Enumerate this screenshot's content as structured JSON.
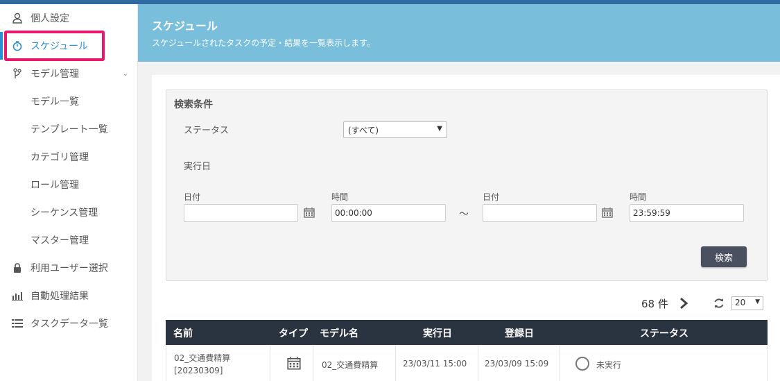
{
  "sidebar": {
    "items": [
      {
        "label": "個人設定",
        "icon": "user-icon"
      },
      {
        "label": "スケジュール",
        "icon": "stopwatch-icon"
      },
      {
        "label": "モデル管理",
        "icon": "branch-icon"
      },
      {
        "label": "モデル一覧"
      },
      {
        "label": "テンプレート一覧"
      },
      {
        "label": "カテゴリ管理"
      },
      {
        "label": "ロール管理"
      },
      {
        "label": "シーケンス管理"
      },
      {
        "label": "マスター管理"
      },
      {
        "label": "利用ユーザー選択",
        "icon": "lock-icon"
      },
      {
        "label": "自動処理結果",
        "icon": "bar-chart-icon"
      },
      {
        "label": "タスクデータ一覧",
        "icon": "list-icon"
      }
    ]
  },
  "header": {
    "title": "スケジュール",
    "description": "スケジュールされたタスクの予定・結果を一覧表示します。"
  },
  "search": {
    "title": "検索条件",
    "status_label": "ステータス",
    "status_value": "(すべて)",
    "exec_date_label": "実行日",
    "date_label": "日付",
    "time_label": "時間",
    "start_date": "",
    "start_time": "00:00:00",
    "tilde": "～",
    "end_date": "",
    "end_time": "23:59:59",
    "button": "検索"
  },
  "pagination": {
    "count": "68 件",
    "page_size": "20"
  },
  "table": {
    "columns": [
      "名前",
      "タイプ",
      "モデル名",
      "実行日",
      "登録日",
      "ステータス"
    ],
    "rows": [
      {
        "name_line1": "02_交通費精算",
        "name_line2": "[20230309]",
        "type_icon": "calendar-icon",
        "model": "02_交通費精算",
        "exec_date": "23/03/11 15:00",
        "reg_date": "23/03/09 15:09",
        "status": "未実行"
      }
    ]
  },
  "colors": {
    "accent": "#2b8fd6",
    "banner": "#79bfdc",
    "highlight": "#e8186e",
    "table_header": "#2a3441"
  }
}
